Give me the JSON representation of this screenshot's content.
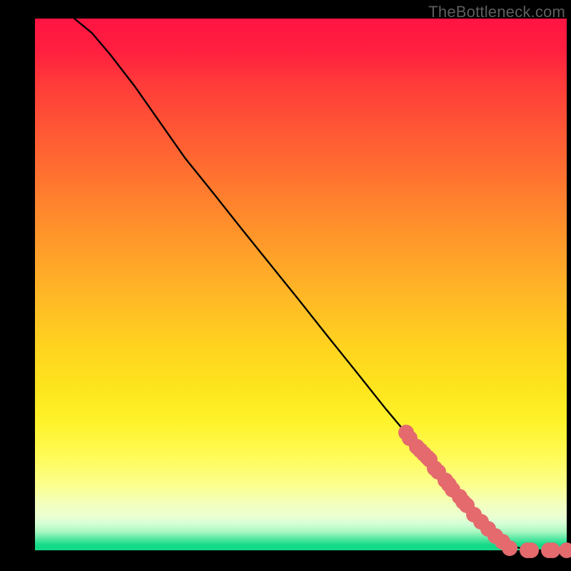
{
  "watermark": "TheBottleneck.com",
  "colors": {
    "dot": "#e46a6e",
    "curve": "#000000",
    "frame_bg": "#000000"
  },
  "chart_data": {
    "type": "line",
    "title": "",
    "xlabel": "",
    "ylabel": "",
    "xlim": [
      0,
      100
    ],
    "ylim": [
      0,
      100
    ],
    "grid": false,
    "legend": false,
    "annotations": [
      "TheBottleneck.com"
    ],
    "series": [
      {
        "name": "curve",
        "style": "line",
        "x": [
          7.4,
          10.7,
          14.1,
          18.8,
          23.5,
          28.2,
          33.6,
          38.9,
          44.3,
          49.7,
          55.0,
          60.4,
          65.8,
          72.5,
          79.2,
          83.9,
          87.2,
          89.9,
          93.3,
          100.0
        ],
        "y": [
          100.0,
          97.3,
          93.3,
          87.2,
          80.5,
          73.8,
          67.1,
          60.4,
          53.7,
          47.0,
          40.3,
          33.6,
          26.8,
          18.8,
          10.7,
          5.4,
          2.0,
          0.7,
          0.0,
          0.0
        ]
      },
      {
        "name": "dots",
        "style": "scatter",
        "x": [
          69.8,
          70.5,
          71.8,
          72.5,
          73.2,
          73.8,
          74.2,
          75.2,
          75.8,
          77.2,
          77.9,
          78.5,
          79.9,
          80.5,
          81.2,
          82.6,
          83.9,
          85.2,
          86.6,
          87.9,
          89.3,
          92.6,
          93.3,
          96.6,
          97.3,
          100.0
        ],
        "y": [
          22.1,
          21.1,
          19.5,
          18.8,
          18.1,
          17.4,
          17.0,
          15.4,
          14.8,
          13.1,
          12.4,
          11.4,
          10.1,
          9.1,
          8.4,
          6.7,
          5.4,
          4.0,
          2.7,
          1.6,
          0.4,
          0.0,
          0.0,
          0.0,
          0.0,
          0.0
        ]
      }
    ]
  }
}
